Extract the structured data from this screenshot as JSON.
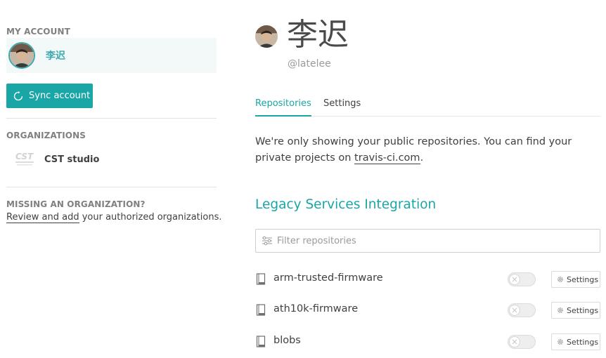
{
  "sidebar": {
    "account_heading": "MY ACCOUNT",
    "account_name": "李迟",
    "sync_label": "Sync account",
    "orgs_heading": "ORGANIZATIONS",
    "orgs": [
      {
        "name": "CST studio",
        "logo_text": "CST"
      }
    ],
    "missing_heading": "MISSING AN ORGANIZATION?",
    "missing_link": "Review and add",
    "missing_rest": " your authorized organizations."
  },
  "profile": {
    "name": "李迟",
    "handle": "@latelee"
  },
  "tabs": [
    {
      "label": "Repositories",
      "active": true
    },
    {
      "label": "Settings",
      "active": false
    }
  ],
  "info": {
    "text_before": "We're only showing your public repositories. You can find your private projects on ",
    "link": "travis-ci.com",
    "text_after": "."
  },
  "legacy_title": "Legacy Services Integration",
  "filter": {
    "placeholder": "Filter repositories",
    "value": ""
  },
  "repos": [
    {
      "name": "arm-trusted-firmware",
      "enabled": false,
      "settings_label": "Settings"
    },
    {
      "name": "ath10k-firmware",
      "enabled": false,
      "settings_label": "Settings"
    },
    {
      "name": "blobs",
      "enabled": false,
      "settings_label": "Settings"
    }
  ],
  "colors": {
    "accent": "#1aa5a6",
    "accent_text": "#3eaaaf",
    "account_bg": "#f3f9f9",
    "muted": "#9a9a9a"
  }
}
